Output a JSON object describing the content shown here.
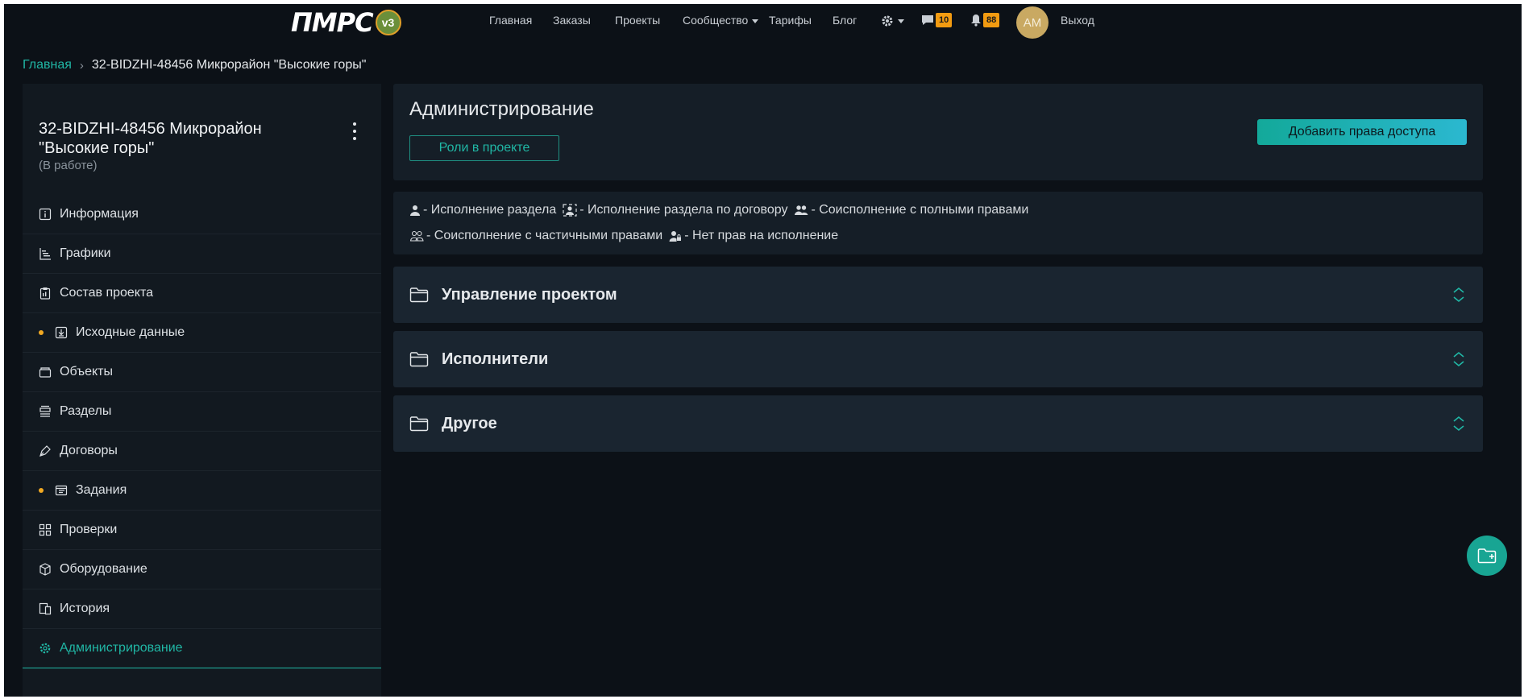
{
  "header": {
    "logo_text": "ПМРС",
    "logo_badge": "v3",
    "nav": [
      "Главная",
      "Заказы",
      "Проекты",
      "Сообщество",
      "Тарифы",
      "Блог"
    ],
    "messages_count": "10",
    "notifications_count": "88",
    "avatar_initials": "АМ",
    "logout_label": "Выход"
  },
  "breadcrumb": {
    "home": "Главная",
    "separator": "›",
    "current": "32-BIDZHI-48456 Микрорайон \"Высокие горы\""
  },
  "sidebar": {
    "project_title": "32-BIDZHI-48456 Микрорайон \"Высокие горы\"",
    "project_status": "(В работе)",
    "items": [
      {
        "label": "Информация",
        "icon": "info-icon"
      },
      {
        "label": "Графики",
        "icon": "gantt-icon"
      },
      {
        "label": "Состав проекта",
        "icon": "clipboard-icon"
      },
      {
        "label": "Исходные данные",
        "icon": "download-box-icon",
        "dot": true
      },
      {
        "label": "Объекты",
        "icon": "box-icon"
      },
      {
        "label": "Разделы",
        "icon": "stack-icon"
      },
      {
        "label": "Договоры",
        "icon": "pen-icon"
      },
      {
        "label": "Задания",
        "icon": "window-icon",
        "dot": true
      },
      {
        "label": "Проверки",
        "icon": "grid-icon"
      },
      {
        "label": "Оборудование",
        "icon": "cube-icon"
      },
      {
        "label": "История",
        "icon": "devices-icon"
      },
      {
        "label": "Администрирование",
        "icon": "gear-icon",
        "active": true
      }
    ]
  },
  "admin": {
    "title": "Администрирование",
    "roles_button": "Роли в проекте",
    "add_button": "Добавить права доступа"
  },
  "legend": [
    "- Исполнение раздела",
    "- Исполнение раздела по договору",
    "- Соисполнение с полными правами",
    "- Соисполнение с частичными правами",
    "- Нет прав на исполнение"
  ],
  "sections": [
    "Управление проектом",
    "Исполнители",
    "Другое"
  ],
  "colors": {
    "accent": "#20b7a5",
    "badge": "#f29b11",
    "background": "#0c1117",
    "panel": "#151e27"
  }
}
